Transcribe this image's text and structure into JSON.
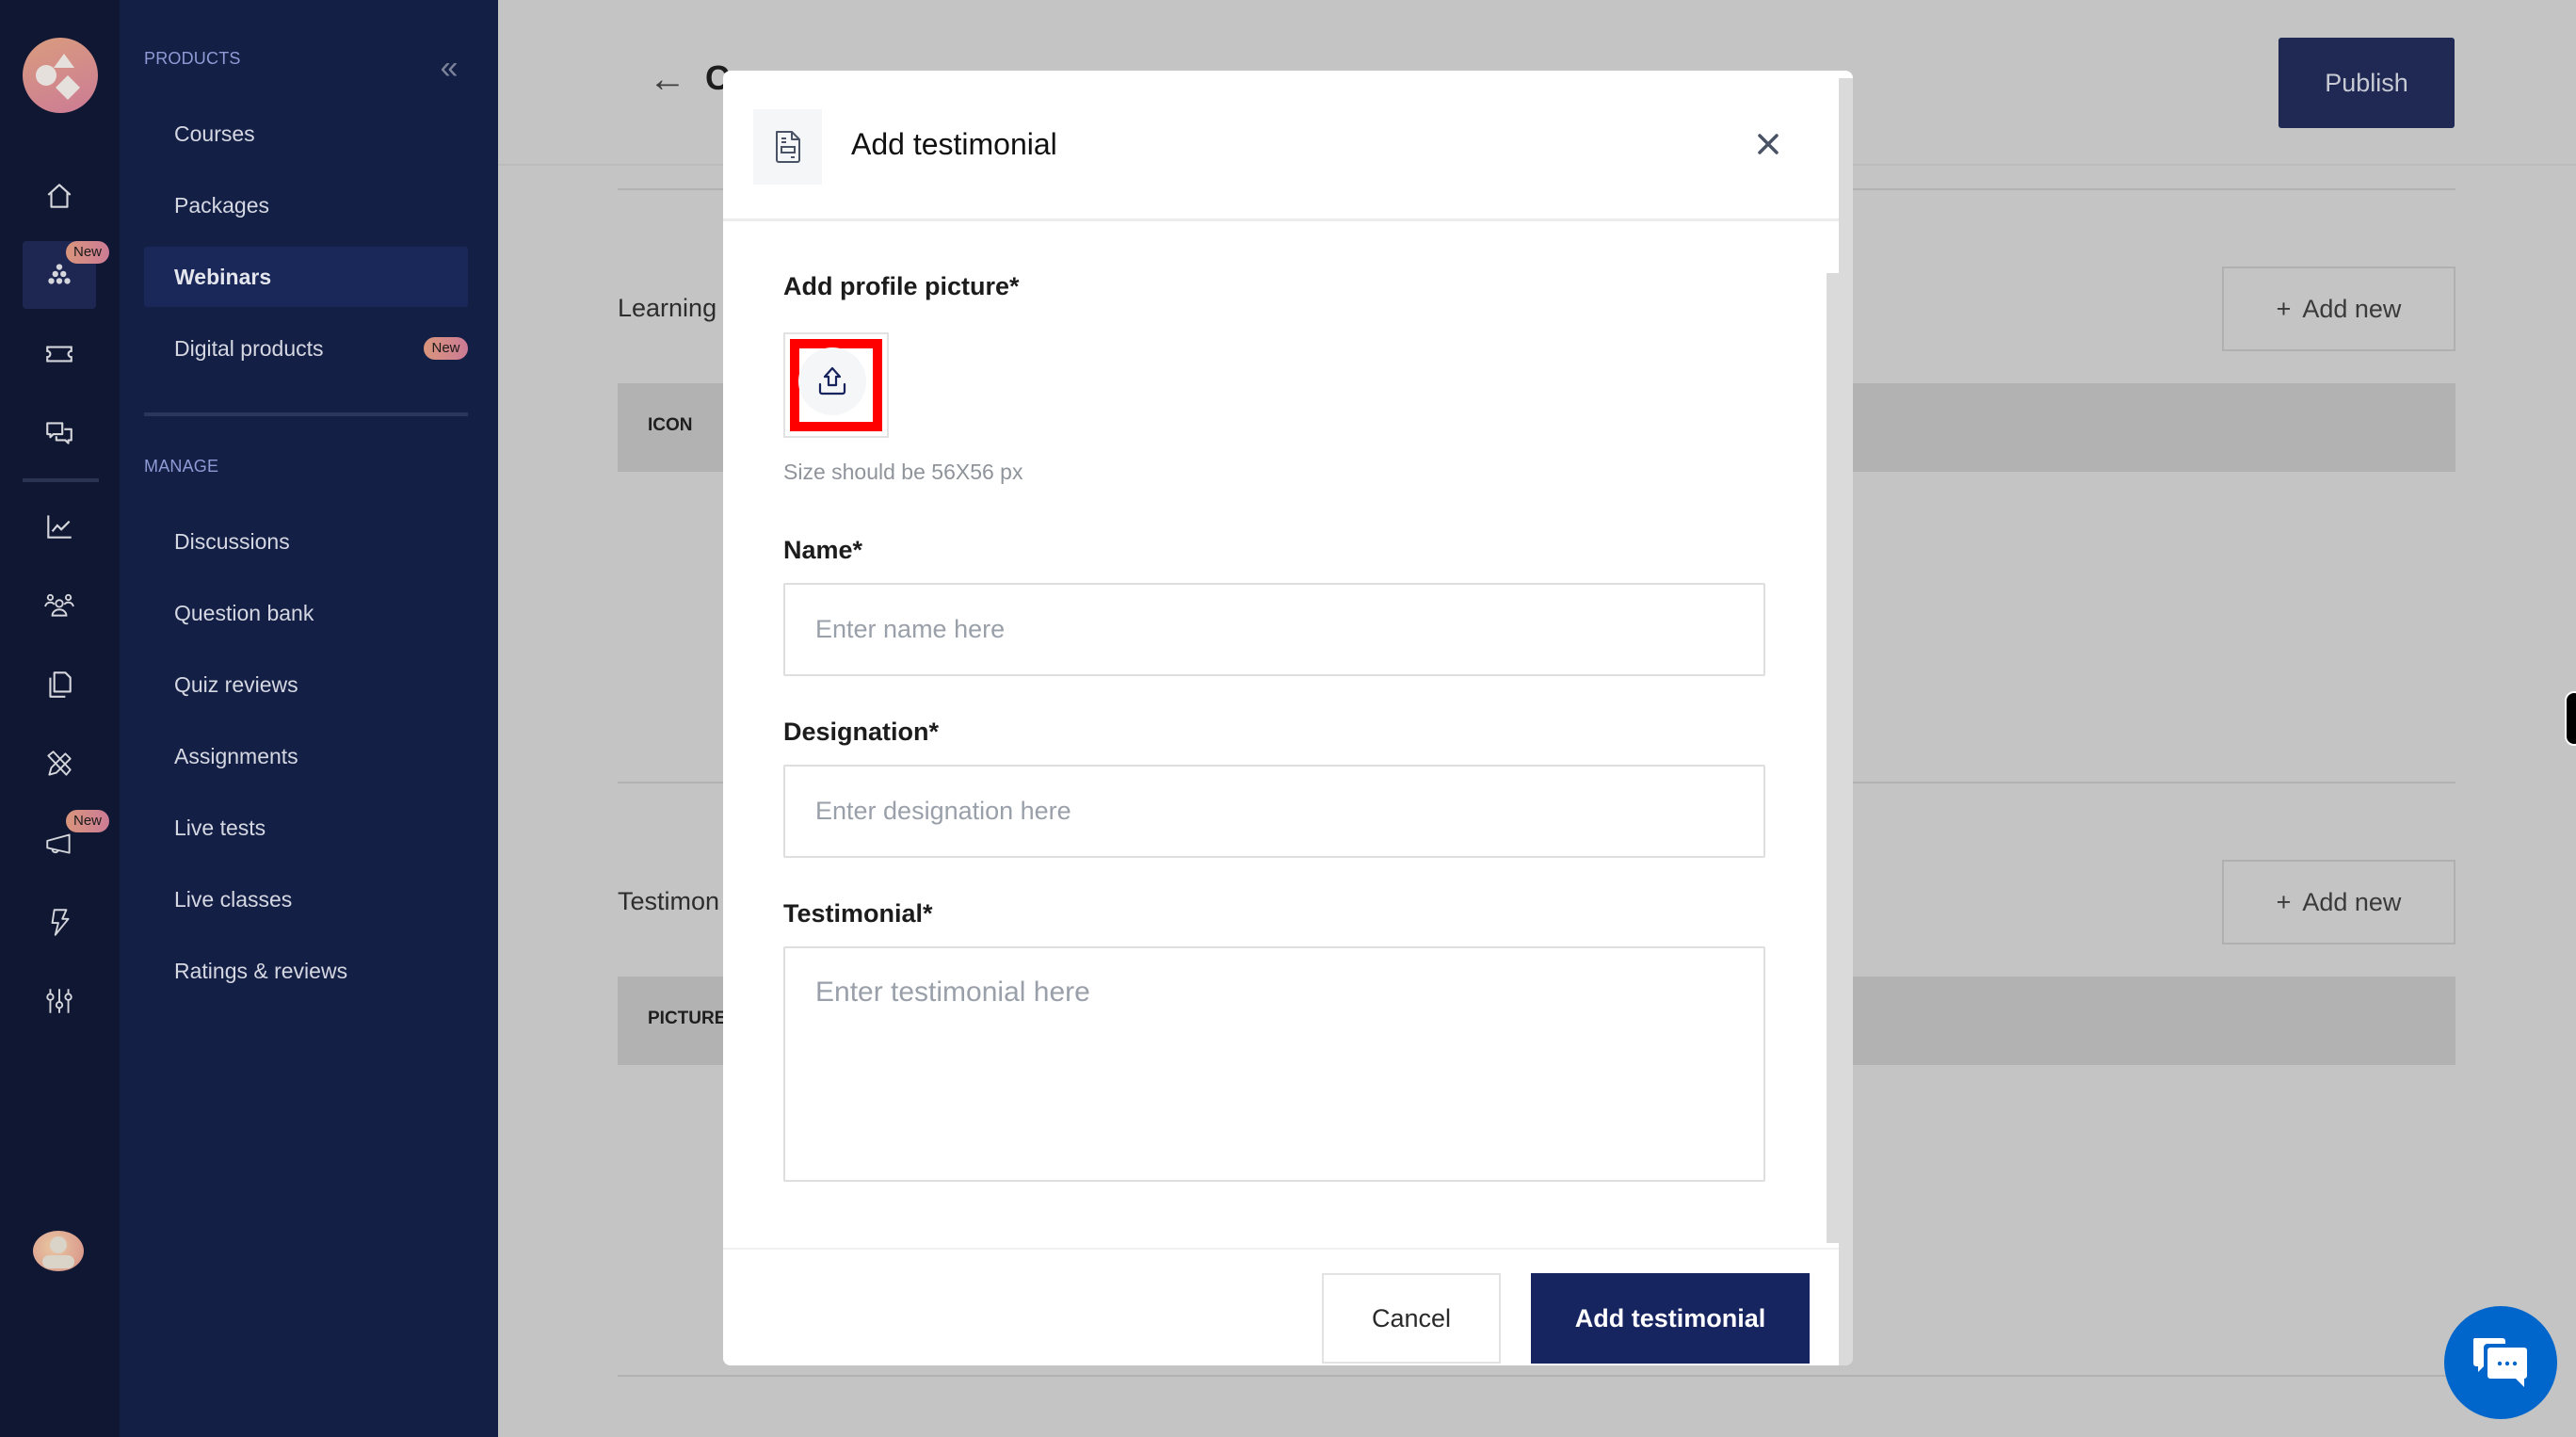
{
  "rail": {
    "badges": {
      "webinars_new": "New",
      "announcements_new": "New"
    },
    "icons": [
      "home-icon",
      "products-icon",
      "ticket-icon",
      "chat-icon",
      "analytics-icon",
      "users-icon",
      "copy-icon",
      "design-tools-icon",
      "megaphone-icon",
      "lightning-icon",
      "settings-sliders-icon"
    ]
  },
  "sidebar": {
    "products_label": "PRODUCTS",
    "manage_label": "MANAGE",
    "collapse_glyph": "«",
    "products": [
      {
        "label": "Courses"
      },
      {
        "label": "Packages"
      },
      {
        "label": "Webinars",
        "active": true
      },
      {
        "label": "Digital products",
        "badge": "New"
      }
    ],
    "manage": [
      {
        "label": "Discussions"
      },
      {
        "label": "Question bank"
      },
      {
        "label": "Quiz reviews"
      },
      {
        "label": "Assignments"
      },
      {
        "label": "Live tests"
      },
      {
        "label": "Live classes"
      },
      {
        "label": "Ratings & reviews"
      }
    ]
  },
  "header": {
    "title_visible": "C",
    "publish_label": "Publish"
  },
  "sections": {
    "learning": {
      "title": "Learning",
      "add_label": "Add new",
      "column": "ICON"
    },
    "testimonials": {
      "title": "Testimon",
      "add_label": "Add new",
      "column": "PICTURE"
    }
  },
  "modal": {
    "title": "Add testimonial",
    "profile_label": "Add profile picture*",
    "size_hint": "Size should be 56X56 px",
    "name_label": "Name*",
    "name_placeholder": "Enter name here",
    "name_value": "",
    "designation_label": "Designation*",
    "designation_placeholder": "Enter designation here",
    "designation_value": "",
    "testimonial_label": "Testimonial*",
    "testimonial_placeholder": "Enter testimonial here",
    "testimonial_value": "",
    "cancel_label": "Cancel",
    "submit_label": "Add testimonial"
  },
  "colors": {
    "brand_navy": "#162460",
    "sidebar_bg": "#141f45",
    "rail_bg": "#101732",
    "highlight_red": "#ff0000",
    "chat_blue": "#0066cc"
  }
}
